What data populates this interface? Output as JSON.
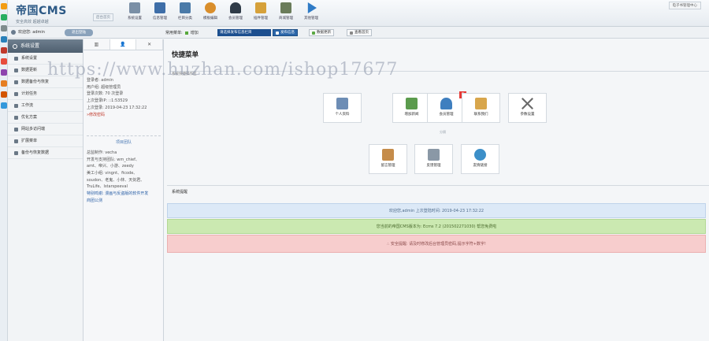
{
  "header": {
    "logo_main": "帝国CMS",
    "logo_sub": "安全高效  超越卓越",
    "logo_badge": "后台首页",
    "nav": [
      {
        "label": "系统设置",
        "icon": "system-icon",
        "color": "#7a8fa6"
      },
      {
        "label": "信息管理",
        "icon": "info-icon",
        "color": "#3e6ea8"
      },
      {
        "label": "栏目分类",
        "icon": "column-icon",
        "color": "#4b7aa8"
      },
      {
        "label": "模板编辑",
        "icon": "template-icon",
        "color": "#d98e2c"
      },
      {
        "label": "会员管理",
        "icon": "member-icon",
        "color": "#2f3b48"
      },
      {
        "label": "插件管理",
        "icon": "plugin-icon",
        "color": "#d6a13a"
      },
      {
        "label": "商城管理",
        "icon": "shop-icon",
        "color": "#6a7c5a"
      },
      {
        "label": "其他管理",
        "icon": "other-icon",
        "color": "#2f7bc6"
      }
    ],
    "topright": "电子书管理中心"
  },
  "subbar": {
    "welcome": "欢迎您: admin",
    "logout": "退出登陆",
    "quick_label": "常用菜单:",
    "quick_add": "增加",
    "select_value": "请选择发布信息栏目",
    "publish": "发布信息",
    "update": "数据更新",
    "home": "查看首页"
  },
  "menu": {
    "title": "系统设置",
    "items": [
      "系统设置",
      "数据更新",
      "数据备份与恢复",
      "计划任务",
      "工作流",
      "优化方案",
      "网站多访问端",
      "扩展菜单",
      "备份与恢复数据"
    ]
  },
  "info": {
    "tabs": [
      "▥",
      "👤",
      "✕"
    ],
    "lines": [
      "登录者: admin",
      "用户组: 超级管理员",
      "登录次数: 70 次登录",
      "上次登录IP: ::1:53529",
      "上次登录: 2019-04-23 17:32:22"
    ],
    "modify_link": "»修改密码",
    "team_title": "项目团队",
    "team_lines": [
      "总监制作: vecha",
      "开发与支持团队: wm_chief、",
      "amt、帝兴、小游、zeedy",
      "美工小组: vingnt、ficode、",
      "soudon、老鬼、小林、天剑君、",
      "TruLife、lstarspeeval",
      "特别鸣谢: 漫画与反盗版的软件开发",
      "商团公测"
    ]
  },
  "main": {
    "title": "快捷菜单",
    "note": "系统快捷操作区",
    "cards": [
      {
        "label": "个人资料",
        "icon": "profile-icon",
        "color": "#6d8db5"
      },
      {
        "label": "增加新闻",
        "icon": "add-news-icon",
        "color": "#5b9b4d"
      },
      {
        "label": "会员管理",
        "icon": "member-manage-icon",
        "color": "#3f7fbf",
        "badge": "0"
      },
      {
        "label": "联系我们",
        "icon": "contact-icon",
        "color": "#d8a64c"
      },
      {
        "label": "参数设置",
        "icon": "settings-icon",
        "color": "#6a6a6a"
      },
      {
        "label": "留言管理",
        "icon": "guestbook-icon",
        "color": "#c58c4a"
      },
      {
        "label": "反馈管理",
        "icon": "feedback-icon",
        "color": "#8a98a6"
      },
      {
        "label": "友情链接",
        "icon": "links-icon",
        "color": "#3c8fc8"
      }
    ],
    "divider": "分隔",
    "notice_title": "系统提醒",
    "alerts": {
      "blue": "欢迎您,admin 上次登陆时间: 2019-04-23 17:32:22",
      "green": "您当前的帝国CMS版本为: Ecms 7.2 (201502271030) 帮您免费啦",
      "red": "∴ 安全提醒: 请及时修改后台管理员密码,提示字符+数字!"
    }
  },
  "watermark": "https://www.huzhan.com/ishop17677",
  "dock_colors": [
    "#f39c12",
    "#27ae60",
    "#7f8c8d",
    "#2980b9",
    "#c0392b",
    "#e74c3c",
    "#8e44ad",
    "#e67e22",
    "#d35400",
    "#3498db"
  ]
}
